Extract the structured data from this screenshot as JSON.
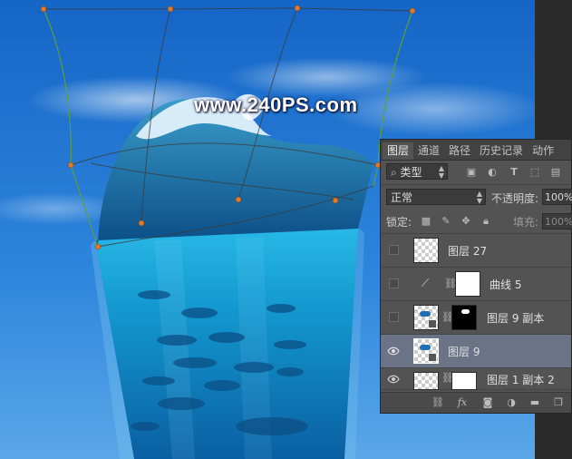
{
  "watermark": "www.240PS.com",
  "panel": {
    "tabs": [
      {
        "label": "图层",
        "active": true
      },
      {
        "label": "通道",
        "active": false
      },
      {
        "label": "路径",
        "active": false
      },
      {
        "label": "历史记录",
        "active": false
      },
      {
        "label": "动作",
        "active": false
      }
    ],
    "filter_kind": "类型",
    "blend_mode": "正常",
    "opacity_label": "不透明度:",
    "opacity_value": "100%",
    "lock_label": "锁定:",
    "fill_label": "填充:",
    "fill_value": "100%",
    "layers": [
      {
        "name": "图层 27",
        "visible": false,
        "selected": false
      },
      {
        "name": "曲线 5",
        "visible": false,
        "selected": false
      },
      {
        "name": "图层 9 副本",
        "visible": false,
        "selected": false
      },
      {
        "name": "图层 9",
        "visible": true,
        "selected": true
      },
      {
        "name": "图层 1 副本 2",
        "visible": true,
        "selected": false
      }
    ]
  },
  "colors": {
    "sky_top": "#1668c8",
    "sky_bottom": "#4b9be4",
    "water": "#1aa3d6",
    "panel_bg": "#535353",
    "selected_row": "#6b7386"
  }
}
